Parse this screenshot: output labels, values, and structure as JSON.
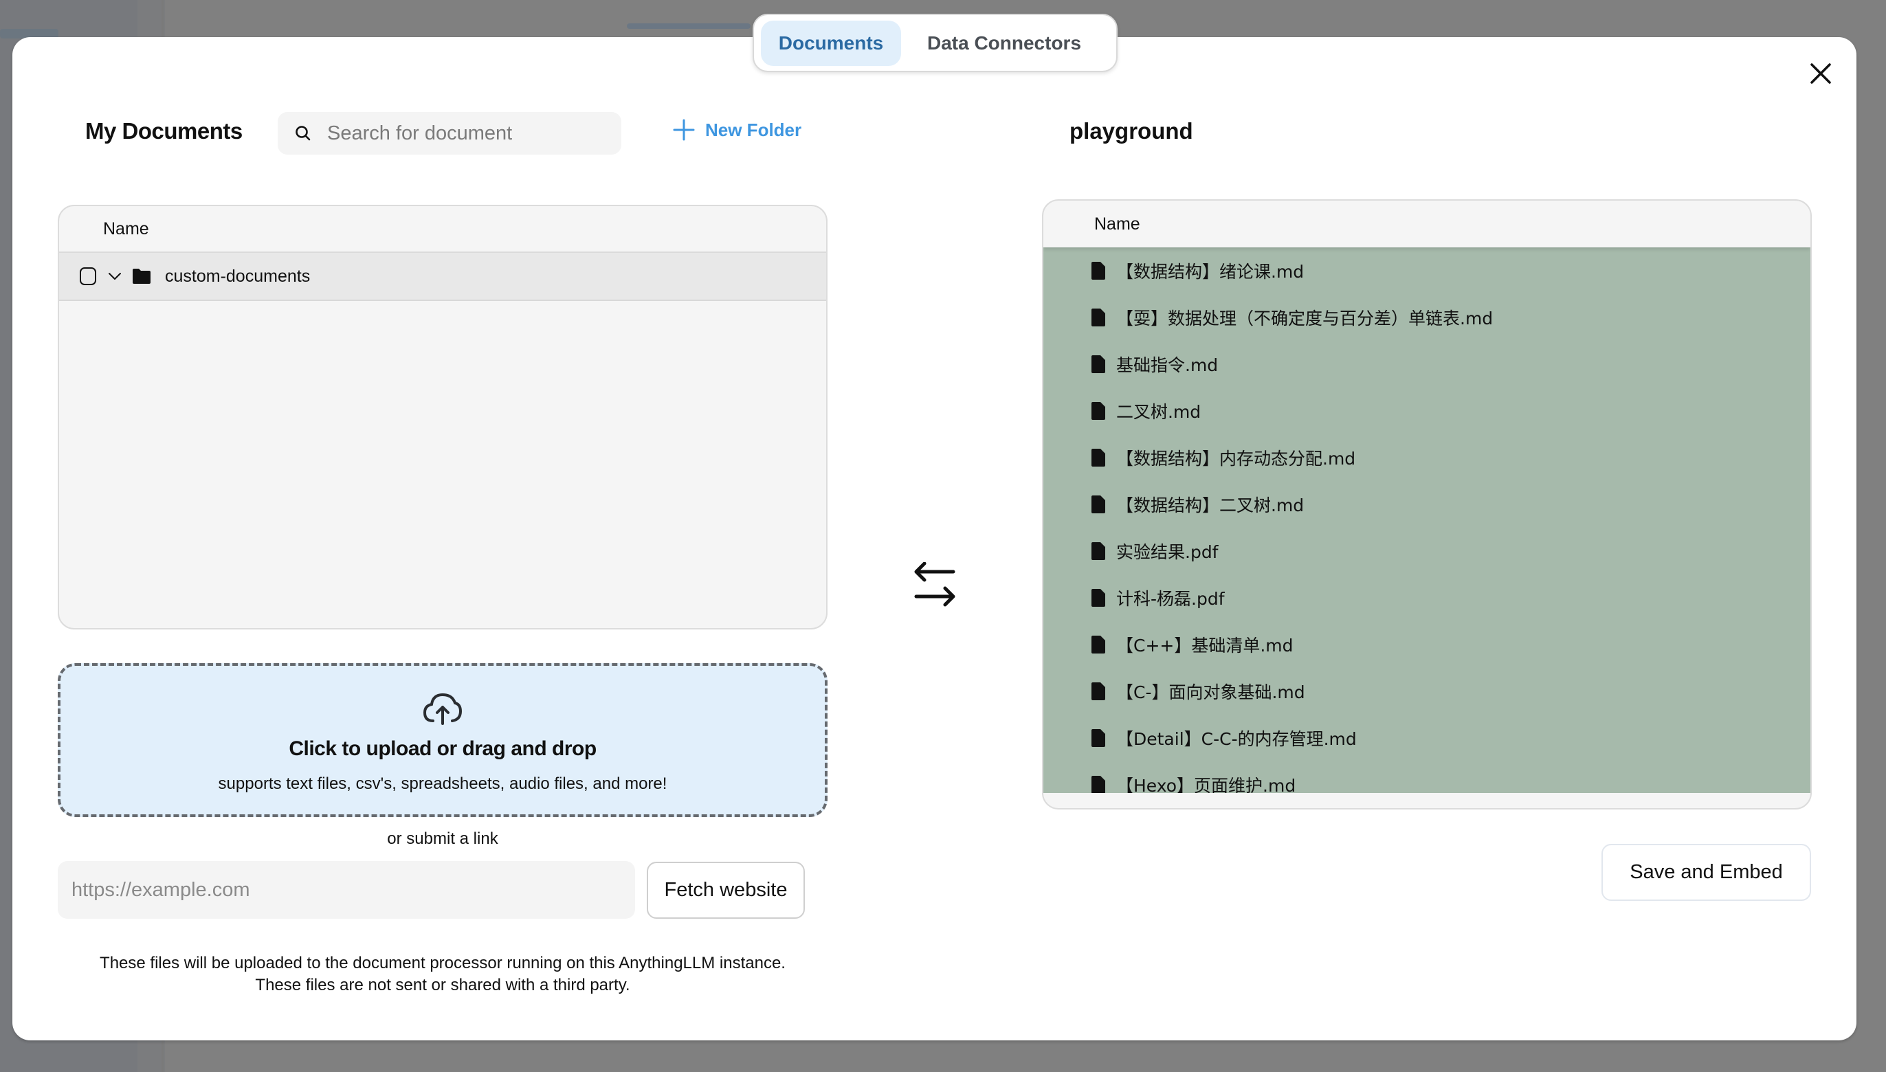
{
  "tabs": [
    {
      "label": "Documents",
      "active": true
    },
    {
      "label": "Data Connectors",
      "active": false
    }
  ],
  "colors": {
    "accent": "#3e96e0",
    "active_tab_bg": "#e1effb",
    "active_tab_text": "#2b6aa3",
    "workspace_list_bg": "#a6baab",
    "upload_zone_bg": "#e1effb"
  },
  "left_panel": {
    "title": "My Documents",
    "search": {
      "placeholder": "Search for document",
      "value": ""
    },
    "new_folder_label": "New Folder",
    "table": {
      "header": "Name",
      "rows": [
        {
          "type": "folder",
          "name": "custom-documents",
          "checked": false,
          "expanded": true
        }
      ]
    },
    "upload": {
      "title": "Click to upload or drag and drop",
      "subtitle": "supports text files, csv's, spreadsheets, audio files, and more!"
    },
    "or_link_label": "or submit a link",
    "link_input": {
      "placeholder": "https://example.com",
      "value": ""
    },
    "fetch_button": "Fetch website",
    "footer_line1": "These files will be uploaded to the document processor running on this AnythingLLM instance.",
    "footer_line2": "These files are not sent or shared with a third party."
  },
  "right_panel": {
    "title": "playground",
    "table": {
      "header": "Name",
      "files": [
        "【数据结构】绪论课.md",
        "【耍】数据处理（不确定度与百分差）单链表.md",
        "基础指令.md",
        "二叉树.md",
        "【数据结构】内存动态分配.md",
        "【数据结构】二叉树.md",
        "实验结果.pdf",
        "计科-杨磊.pdf",
        "【C++】基础清单.md",
        "【C-】面向对象基础.md",
        "【Detail】C-C-的内存管理.md",
        "【Hexo】页面维护.md"
      ]
    },
    "save_button": "Save and Embed"
  },
  "icons": {
    "close": "close-icon",
    "search": "search-icon",
    "plus": "plus-icon",
    "folder": "folder-icon",
    "chevron": "chevron-down-icon",
    "upload": "cloud-upload-icon",
    "swap": "arrows-left-right-icon",
    "file": "file-icon"
  }
}
